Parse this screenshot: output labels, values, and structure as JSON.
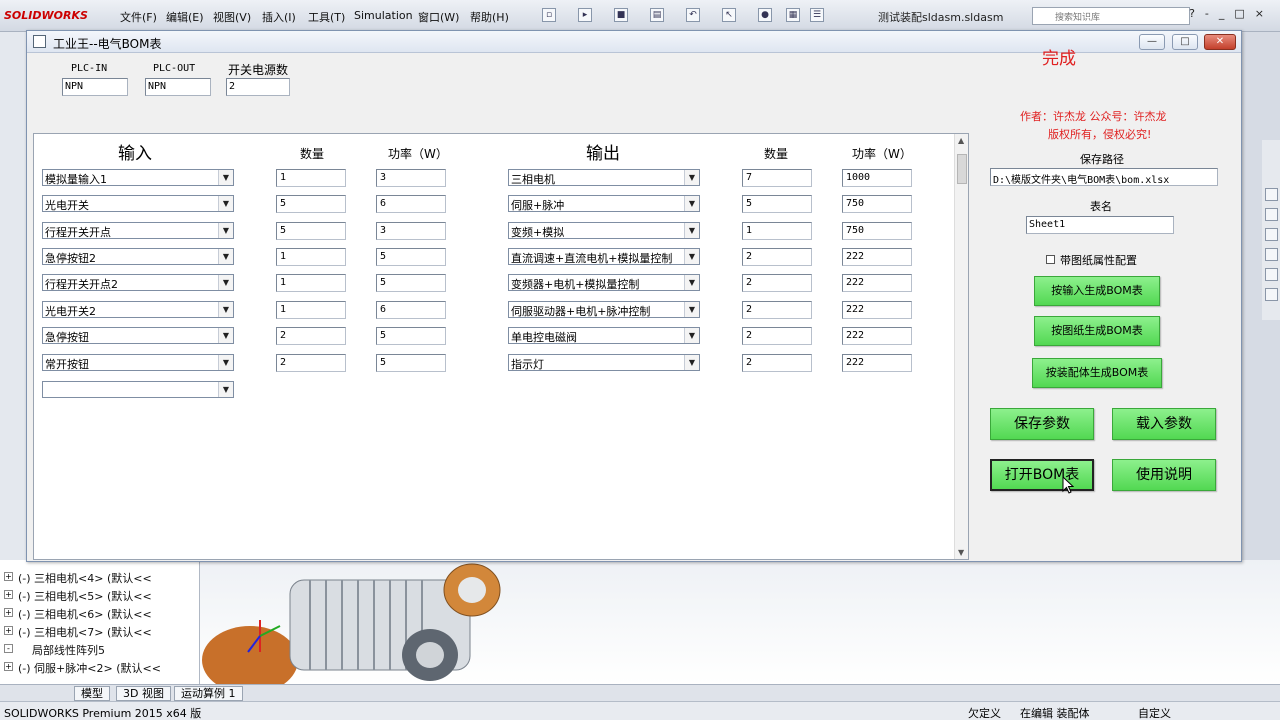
{
  "solidworks": {
    "logo": "SOLIDWORKS",
    "menu": [
      "文件(F)",
      "编辑(E)",
      "视图(V)",
      "插入(I)",
      "工具(T)",
      "Simulation",
      "窗口(W)",
      "帮助(H)"
    ],
    "doc_title": "测试装配sldasm.sldasm",
    "search_placeholder": "搜索知识库",
    "tree": [
      {
        "label": "(-) 三相电机<4> (默认<<"
      },
      {
        "label": "(-) 三相电机<5> (默认<<"
      },
      {
        "label": "(-) 三相电机<6> (默认<<"
      },
      {
        "label": "(-) 三相电机<7> (默认<<"
      },
      {
        "label": "局部线性阵列5"
      },
      {
        "label": "(-) 伺服+脉冲<2> (默认<<"
      }
    ],
    "tabs": [
      "模型",
      "3D 视图",
      "运动算例 1"
    ],
    "status": {
      "product": "SOLIDWORKS Premium 2015 x64 版",
      "undefined": "欠定义",
      "editing": "在编辑 装配体",
      "custom": "自定义"
    }
  },
  "app": {
    "title": "工业王--电气BOM表",
    "top": {
      "plc_in_label": "PLC-IN",
      "plc_in_value": "NPN",
      "plc_out_label": "PLC-OUT",
      "plc_out_value": "NPN",
      "switch_power_label": "开关电源数",
      "switch_power_value": "2"
    },
    "input_section": {
      "title": "输入",
      "qty_header": "数量",
      "power_header": "功率（W）",
      "rows": [
        {
          "name": "模拟量输入1",
          "qty": "1",
          "power": "3"
        },
        {
          "name": "光电开关",
          "qty": "5",
          "power": "6"
        },
        {
          "name": "行程开关开点",
          "qty": "5",
          "power": "3"
        },
        {
          "name": "急停按钮2",
          "qty": "1",
          "power": "5"
        },
        {
          "name": "行程开关开点2",
          "qty": "1",
          "power": "5"
        },
        {
          "name": "光电开关2",
          "qty": "1",
          "power": "6"
        },
        {
          "name": "急停按钮",
          "qty": "2",
          "power": "5"
        },
        {
          "name": "常开按钮",
          "qty": "2",
          "power": "5"
        }
      ],
      "empty_row": ""
    },
    "output_section": {
      "title": "输出",
      "qty_header": "数量",
      "power_header": "功率（W）",
      "rows": [
        {
          "name": "三相电机",
          "qty": "7",
          "power": "1000"
        },
        {
          "name": "伺服+脉冲",
          "qty": "5",
          "power": "750"
        },
        {
          "name": "变频+模拟",
          "qty": "1",
          "power": "750"
        },
        {
          "name": "直流调速+直流电机+模拟量控制",
          "qty": "2",
          "power": "222"
        },
        {
          "name": "变频器+电机+模拟量控制",
          "qty": "2",
          "power": "222"
        },
        {
          "name": "伺服驱动器+电机+脉冲控制",
          "qty": "2",
          "power": "222"
        },
        {
          "name": "单电控电磁阀",
          "qty": "2",
          "power": "222"
        },
        {
          "name": "指示灯",
          "qty": "2",
          "power": "222"
        }
      ]
    },
    "side": {
      "status": "完成",
      "author": "作者：许杰龙  公众号：许杰龙",
      "copyright": "版权所有，侵权必究!",
      "save_path_label": "保存路径",
      "save_path_value": "D:\\模版文件夹\\电气BOM表\\bom.xlsx",
      "sheet_label": "表名",
      "sheet_value": "Sheet1",
      "checkbox_label": "带图纸属性配置",
      "checkbox_checked": false,
      "btn_by_input": "按输入生成BOM表",
      "btn_by_drawing": "按图纸生成BOM表",
      "btn_by_assembly": "按装配体生成BOM表",
      "btn_save_params": "保存参数",
      "btn_load_params": "载入参数",
      "btn_open_bom": "打开BOM表",
      "btn_help": "使用说明"
    }
  }
}
